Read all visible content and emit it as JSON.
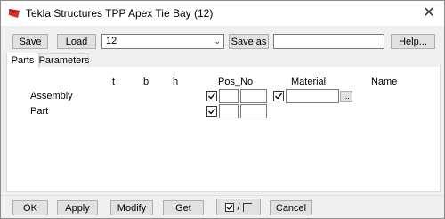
{
  "window": {
    "title": "Tekla Structures  TPP Apex Tie Bay (12)"
  },
  "toolbar": {
    "save_label": "Save",
    "load_label": "Load",
    "attribute_set_value": "12",
    "save_as_label": "Save as",
    "save_as_value": "",
    "help_label": "Help..."
  },
  "tabs": [
    {
      "label": "Parts",
      "active": true
    },
    {
      "label": "Parameters",
      "active": false
    }
  ],
  "parts": {
    "headers": {
      "t": "t",
      "b": "b",
      "h": "h",
      "pos_no": "Pos_No",
      "material": "Material",
      "name": "Name"
    },
    "rows": [
      {
        "label": "Assembly",
        "pos_checked": true,
        "prefix": "",
        "start_no": "",
        "material_checked": true,
        "material": ""
      },
      {
        "label": "Part",
        "pos_checked": true,
        "prefix": "",
        "start_no": ""
      }
    ],
    "ellipsis_label": "..."
  },
  "footer": {
    "ok_label": "OK",
    "apply_label": "Apply",
    "modify_label": "Modify",
    "get_label": "Get",
    "toggle_separator": "/",
    "cancel_label": "Cancel"
  },
  "icons": {
    "app": "tekla-logo-icon",
    "close": "close-icon"
  },
  "colors": {
    "app_icon": "#d92b2b",
    "window_bg": "#f0f0f0",
    "button_bg": "#e1e1e1"
  }
}
